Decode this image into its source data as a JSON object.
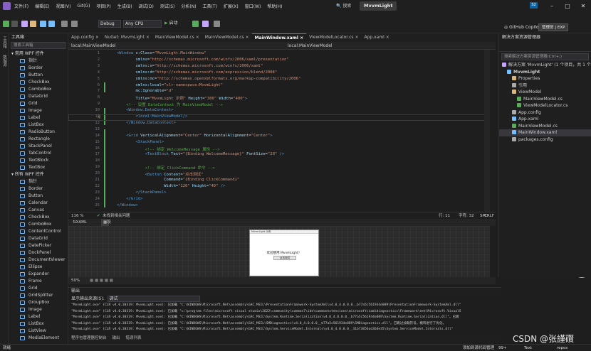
{
  "menu": [
    "文件(F)",
    "编辑(E)",
    "视图(V)",
    "Git(G)",
    "项目(P)",
    "生成(B)",
    "调试(D)",
    "测试(S)",
    "分析(N)",
    "工具(T)",
    "扩展(X)",
    "窗口(W)",
    "帮助(H)"
  ],
  "search_label": "搜索",
  "solution_title": "MvvmLight",
  "toolbar": {
    "config": "Debug",
    "platform": "Any CPU",
    "run_label": "启动",
    "copilot": "GitHub Copilot",
    "admin": "管理员 | EXP",
    "badge": "S2"
  },
  "left_strip": [
    "工具箱",
    "数据源"
  ],
  "toolbox": {
    "title": "工具箱",
    "search_placeholder": "搜索工具箱",
    "categories": [
      {
        "name": "常用 WPF 控件",
        "items": [
          "指针",
          "Border",
          "Button",
          "CheckBox",
          "ComboBox",
          "DataGrid",
          "Grid",
          "Image",
          "Label",
          "ListBox",
          "RadioButton",
          "Rectangle",
          "StackPanel",
          "TabControl",
          "TextBlock",
          "TextBox"
        ]
      },
      {
        "name": "所有 WPF 控件",
        "items": [
          "指针",
          "Border",
          "Button",
          "Calendar",
          "Canvas",
          "CheckBox",
          "ComboBox",
          "ContentControl",
          "DataGrid",
          "DatePicker",
          "DockPanel",
          "DocumentViewer",
          "Ellipse",
          "Expander",
          "Frame",
          "Grid",
          "GridSplitter",
          "GroupBox",
          "Image",
          "Label",
          "ListBox",
          "ListView",
          "MediaElement"
        ]
      }
    ]
  },
  "tabs": [
    "App.config",
    "NuGet: MvvmLight",
    "MainViewModel.cs",
    "MainViewModel.cs",
    "MainWindow.xaml",
    "ViewModelLocator.cs",
    "App.xaml"
  ],
  "active_tab_index": 4,
  "nav": {
    "left": "local:MainViewModel",
    "right": "local:MainViewModel"
  },
  "code_lines": [
    {
      "n": "1",
      "parts": [
        [
          "tag",
          "<Window "
        ],
        [
          "attr",
          "x:Class"
        ],
        [
          "plain",
          "="
        ],
        [
          "str",
          "\"MvvmLight.MainWindow\""
        ]
      ]
    },
    {
      "n": "2",
      "parts": [
        [
          "attr",
          "        xmlns"
        ],
        [
          "plain",
          "="
        ],
        [
          "str",
          "\"http://schemas.microsoft.com/winfx/2006/xaml/presentation\""
        ]
      ]
    },
    {
      "n": "3",
      "parts": [
        [
          "attr",
          "        xmlns:x"
        ],
        [
          "plain",
          "="
        ],
        [
          "str",
          "\"http://schemas.microsoft.com/winfx/2006/xaml\""
        ]
      ]
    },
    {
      "n": "4",
      "parts": [
        [
          "attr",
          "        xmlns:d"
        ],
        [
          "plain",
          "="
        ],
        [
          "str",
          "\"http://schemas.microsoft.com/expression/blend/2008\""
        ]
      ]
    },
    {
      "n": "5",
      "parts": [
        [
          "attr",
          "        xmlns:mc"
        ],
        [
          "plain",
          "="
        ],
        [
          "str",
          "\"http://schemas.openxmlformats.org/markup-compatibility/2006\""
        ]
      ]
    },
    {
      "n": "6",
      "parts": [
        [
          "attr",
          "        xmlns:local"
        ],
        [
          "plain",
          "="
        ],
        [
          "str",
          "\"clr-namespace:MvvmLight\""
        ]
      ]
    },
    {
      "n": "7",
      "parts": [
        [
          "attr",
          "        mc:Ignorable"
        ],
        [
          "plain",
          "="
        ],
        [
          "str",
          "\"d\""
        ]
      ]
    },
    {
      "n": "8",
      "parts": [
        [
          "attr",
          "        Title"
        ],
        [
          "plain",
          "="
        ],
        [
          "str",
          "\"MvvmLight 示例\" "
        ],
        [
          "attr",
          "Height"
        ],
        [
          "plain",
          "="
        ],
        [
          "str",
          "\"300\" "
        ],
        [
          "attr",
          "Width"
        ],
        [
          "plain",
          "="
        ],
        [
          "str",
          "\"400\""
        ],
        [
          "tag",
          ">"
        ]
      ]
    },
    {
      "n": "9",
      "parts": [
        [
          "com",
          "    <!-- 设置 DataContext 为 MainViewModel -->"
        ]
      ]
    },
    {
      "n": "10",
      "parts": [
        [
          "tag",
          "    <Window.DataContext>"
        ]
      ]
    },
    {
      "n": "11",
      "parts": [
        [
          "tag",
          "        <local:MainViewModel/>"
        ]
      ]
    },
    {
      "n": "12",
      "parts": [
        [
          "tag",
          "    </Window.DataContext>"
        ]
      ]
    },
    {
      "n": "13",
      "parts": [
        [
          "plain",
          ""
        ]
      ]
    },
    {
      "n": "14",
      "parts": [
        [
          "tag",
          "    <Grid "
        ],
        [
          "attr",
          "VerticalAlignment"
        ],
        [
          "plain",
          "="
        ],
        [
          "str",
          "\"Center\" "
        ],
        [
          "attr",
          "HorizontalAlignment"
        ],
        [
          "plain",
          "="
        ],
        [
          "str",
          "\"Center\""
        ],
        [
          "tag",
          ">"
        ]
      ]
    },
    {
      "n": "15",
      "parts": [
        [
          "tag",
          "        <StackPanel>"
        ]
      ]
    },
    {
      "n": "16",
      "parts": [
        [
          "com",
          "            <!-- 绑定 WelcomeMessage 属性 -->"
        ]
      ]
    },
    {
      "n": "17",
      "parts": [
        [
          "tag",
          "            <TextBlock "
        ],
        [
          "attr",
          "Text"
        ],
        [
          "plain",
          "="
        ],
        [
          "str",
          "\"{Binding WelcomeMessage}\" "
        ],
        [
          "attr",
          "FontSize"
        ],
        [
          "plain",
          "="
        ],
        [
          "str",
          "\"20\" "
        ],
        [
          "tag",
          "/>"
        ]
      ]
    },
    {
      "n": "18",
      "parts": [
        [
          "plain",
          ""
        ]
      ]
    },
    {
      "n": "19",
      "parts": [
        [
          "com",
          "            <!-- 绑定 ClickCommand 命令 -->"
        ]
      ]
    },
    {
      "n": "20",
      "parts": [
        [
          "tag",
          "            <Button "
        ],
        [
          "attr",
          "Content"
        ],
        [
          "plain",
          "="
        ],
        [
          "str",
          "\"点击测试\""
        ]
      ]
    },
    {
      "n": "21",
      "parts": [
        [
          "attr",
          "                    Command"
        ],
        [
          "plain",
          "="
        ],
        [
          "str",
          "\"{Binding ClickCommand}\""
        ]
      ]
    },
    {
      "n": "22",
      "parts": [
        [
          "attr",
          "                    Width"
        ],
        [
          "plain",
          "="
        ],
        [
          "str",
          "\"120\" "
        ],
        [
          "attr",
          "Height"
        ],
        [
          "plain",
          "="
        ],
        [
          "str",
          "\"40\" "
        ],
        [
          "tag",
          "/>"
        ]
      ]
    },
    {
      "n": "23",
      "parts": [
        [
          "tag",
          "        </StackPanel>"
        ]
      ]
    },
    {
      "n": "24",
      "parts": [
        [
          "tag",
          "    </Grid>"
        ]
      ]
    },
    {
      "n": "25",
      "parts": [
        [
          "tag",
          "</Window>"
        ]
      ]
    }
  ],
  "editor_status": {
    "zoom": "116 %",
    "issues": "未找到相关问题",
    "line": "行: 11",
    "col": "字符: 32",
    "spc": "SPC",
    "crlf": "CRLF"
  },
  "design_bar": {
    "xaml": "XAML",
    "design": "设计"
  },
  "preview": {
    "title": "MvvmLight 示例",
    "message": "欢迎使用 MvvmLight！",
    "button": "点击测试"
  },
  "zoom_bar": {
    "zoom": "50%"
  },
  "output": {
    "title": "输出",
    "source_label": "显示输出来源(S):",
    "source_value": "调试",
    "lines": [
      "\"MvvmLight.exe\" (CLR v4.0.30319: MvvmLight.exe): 已加载 \"C:\\WINDOWS\\Microsoft.Net\\assembly\\GAC_MSIL\\PresentationFramework-SystemXml\\v4.0_4.0.0.0__b77a5c561934e089\\PresentationFramework-SystemXml.dll\"",
      "\"MvvmLight.exe\" (CLR v4.0.30319: MvvmLight.exe): 已加载 \"c:\\program files\\microsoft visual studio\\2022\\community\\common7\\ide\\commonextensions\\microsoft\\xamldiagnostics\\Framework\\net\\Microsoft.VisualS",
      "\"MvvmLight.exe\" (CLR v4.0.30319: MvvmLight.exe): 已加载 \"C:\\WINDOWS\\Microsoft.Net\\assembly\\GAC_MSIL\\System.Runtime.Serialization\\v4.0_4.0.0.0__b77a5c561934e089\\System.Runtime.Serialization.dll\"。已跳",
      "\"MvvmLight.exe\" (CLR v4.0.30319: MvvmLight.exe): 已加载 \"C:\\WINDOWS\\Microsoft.Net\\assembly\\GAC_MSIL\\SMDiagnostics\\v4.0_4.0.0.0__b77a5c561934e089\\SMDiagnostics.dll\"。已跳过加载符号。模块进行了优化，",
      "\"MvvmLight.exe\" (CLR v4.0.30319: MvvmLight.exe): 已加载 \"C:\\WINDOWS\\Microsoft.Net\\assembly\\GAC_MSIL\\System.ServiceModel.Internals\\v4.0_4.0.0.0__31bf3856ad364e35\\System.ServiceModel.Internals.dll\""
    ]
  },
  "output_tabs": [
    "程序包管理器控制台",
    "输出",
    "错误列表"
  ],
  "solution_explorer": {
    "title": "解决方案资源管理器",
    "search_placeholder": "搜索解决方案资源管理器(Ctrl+;)",
    "nodes": [
      {
        "label": "解决方案 'MvvmLight' (1 个项目，共 1 个)",
        "indent": 0,
        "color": "#c5a5ff",
        "selected": false
      },
      {
        "label": "MvvmLight",
        "indent": 1,
        "color": "#75beff",
        "selected": false,
        "bold": true
      },
      {
        "label": "Properties",
        "indent": 2,
        "color": "#dcb67a",
        "selected": false
      },
      {
        "label": "引用",
        "indent": 2,
        "color": "#aaaaaa",
        "selected": false
      },
      {
        "label": "ViewModel",
        "indent": 2,
        "color": "#dcb67a",
        "selected": false
      },
      {
        "label": "MainViewModel.cs",
        "indent": 3,
        "color": "#57ab5a",
        "selected": false
      },
      {
        "label": "ViewModelLocator.cs",
        "indent": 3,
        "color": "#57ab5a",
        "selected": false
      },
      {
        "label": "App.config",
        "indent": 2,
        "color": "#aaaaaa",
        "selected": false
      },
      {
        "label": "App.xaml",
        "indent": 2,
        "color": "#75beff",
        "selected": false
      },
      {
        "label": "MainViewModel.cs",
        "indent": 2,
        "color": "#57ab5a",
        "selected": false
      },
      {
        "label": "MainWindow.xaml",
        "indent": 2,
        "color": "#75beff",
        "selected": true
      },
      {
        "label": "packages.config",
        "indent": 2,
        "color": "#aaaaaa",
        "selected": false
      }
    ]
  },
  "statusbar": {
    "left": "就绪",
    "errors": "99+",
    "text": "Text",
    "repos": "repos",
    "add": "添加到源代码管理"
  },
  "watermark": "CSDN @张謹礥",
  "colors": {
    "accent": "#8661c5",
    "bg": "#1e1e1e",
    "panel": "#1f1f1f"
  }
}
